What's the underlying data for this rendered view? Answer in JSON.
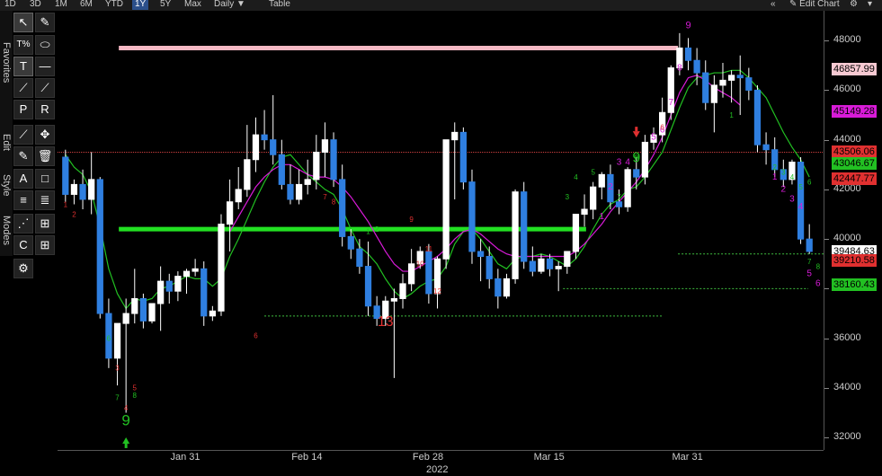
{
  "toolbar": {
    "ranges": [
      "1D",
      "3D",
      "1M",
      "6M",
      "YTD",
      "1Y",
      "5Y",
      "Max"
    ],
    "active_range": "1Y",
    "period": "Daily",
    "period_arrow": "▼",
    "table": "Table",
    "collapse": "«",
    "edit_icon": "✎",
    "edit_chart": "Edit Chart",
    "gear": "⚙",
    "menu": "▾"
  },
  "side_tabs": [
    "Favorites",
    "Edit",
    "Style",
    "Modes"
  ],
  "tools": [
    "↖",
    "T%",
    "⬭",
    "T",
    "—",
    "⟋",
    "⟋",
    "P",
    "R",
    "⟋",
    "✥",
    "✎",
    "🗑",
    "A",
    "□",
    "≡",
    "≣",
    "⋰",
    "⊞",
    "C",
    "⊞",
    "⚙"
  ],
  "chart_data": {
    "type": "candlestick",
    "title": "",
    "xlabel": "2022",
    "ylabel": "",
    "ylim": [
      31500,
      49200
    ],
    "y_ticks": [
      32000,
      34000,
      36000,
      38000,
      40000,
      42000,
      44000,
      46000,
      48000
    ],
    "y_tick_labels": [
      "32000",
      "34000",
      "36000",
      "38000",
      "40000",
      "42000",
      "44000",
      "46000",
      "48000"
    ],
    "x_tick_labels": [
      "Jan 31",
      "Feb 14",
      "Feb 28",
      "Mar 15",
      "Mar 31"
    ],
    "x_tick_days": [
      14,
      28,
      42,
      56,
      72
    ],
    "x_year": "2022",
    "candles": [
      {
        "o": 43300,
        "h": 43600,
        "c": 41800,
        "l": 41500
      },
      {
        "o": 41800,
        "h": 42400,
        "c": 42200,
        "l": 41400
      },
      {
        "o": 42200,
        "h": 42800,
        "c": 41600,
        "l": 41200
      },
      {
        "o": 41600,
        "h": 43500,
        "c": 42400,
        "l": 41000
      },
      {
        "o": 42400,
        "h": 42500,
        "c": 37000,
        "l": 36800
      },
      {
        "o": 37000,
        "h": 37600,
        "c": 35200,
        "l": 34800
      },
      {
        "o": 35200,
        "h": 36500,
        "c": 36600,
        "l": 34100
      },
      {
        "o": 36600,
        "h": 37600,
        "c": 37000,
        "l": 33000
      },
      {
        "o": 37000,
        "h": 38800,
        "c": 37600,
        "l": 36600
      },
      {
        "o": 37600,
        "h": 37800,
        "c": 36700,
        "l": 36400
      },
      {
        "o": 36700,
        "h": 37300,
        "c": 37400,
        "l": 36600
      },
      {
        "o": 37400,
        "h": 38900,
        "c": 38300,
        "l": 36300
      },
      {
        "o": 38300,
        "h": 38600,
        "c": 37900,
        "l": 37400
      },
      {
        "o": 37900,
        "h": 38700,
        "c": 38500,
        "l": 37500
      },
      {
        "o": 38500,
        "h": 38800,
        "c": 38700,
        "l": 37800
      },
      {
        "o": 38700,
        "h": 39200,
        "c": 38800,
        "l": 38500
      },
      {
        "o": 38800,
        "h": 39100,
        "c": 36900,
        "l": 36500
      },
      {
        "o": 36900,
        "h": 37300,
        "c": 37100,
        "l": 36700
      },
      {
        "o": 37100,
        "h": 41000,
        "c": 40600,
        "l": 36900
      },
      {
        "o": 40600,
        "h": 42400,
        "c": 41500,
        "l": 39500
      },
      {
        "o": 41500,
        "h": 42900,
        "c": 42000,
        "l": 41200
      },
      {
        "o": 42000,
        "h": 44600,
        "c": 43200,
        "l": 41700
      },
      {
        "o": 43200,
        "h": 44900,
        "c": 44200,
        "l": 42700
      },
      {
        "o": 44200,
        "h": 45200,
        "c": 44000,
        "l": 43600
      },
      {
        "o": 44000,
        "h": 45800,
        "c": 43400,
        "l": 43000
      },
      {
        "o": 43400,
        "h": 44000,
        "c": 42200,
        "l": 42000
      },
      {
        "o": 42200,
        "h": 43000,
        "c": 41600,
        "l": 41400
      },
      {
        "o": 41600,
        "h": 42800,
        "c": 42200,
        "l": 41400
      },
      {
        "o": 42200,
        "h": 43200,
        "c": 42400,
        "l": 41800
      },
      {
        "o": 42400,
        "h": 44200,
        "c": 43500,
        "l": 42000
      },
      {
        "o": 43500,
        "h": 44700,
        "c": 44000,
        "l": 42500
      },
      {
        "o": 44000,
        "h": 44300,
        "c": 42400,
        "l": 42100
      },
      {
        "o": 42400,
        "h": 43000,
        "c": 40100,
        "l": 39700
      },
      {
        "o": 40100,
        "h": 40400,
        "c": 39600,
        "l": 39200
      },
      {
        "o": 39600,
        "h": 40000,
        "c": 38900,
        "l": 38600
      },
      {
        "o": 38900,
        "h": 39900,
        "c": 37300,
        "l": 36900
      },
      {
        "o": 37300,
        "h": 37700,
        "c": 36800,
        "l": 36500
      },
      {
        "o": 36800,
        "h": 37700,
        "c": 37500,
        "l": 36500
      },
      {
        "o": 37500,
        "h": 38000,
        "c": 37600,
        "l": 34400
      },
      {
        "o": 37600,
        "h": 38600,
        "c": 38200,
        "l": 37200
      },
      {
        "o": 38200,
        "h": 39600,
        "c": 39000,
        "l": 37900
      },
      {
        "o": 39000,
        "h": 39700,
        "c": 39500,
        "l": 38800
      },
      {
        "o": 39500,
        "h": 39800,
        "c": 37800,
        "l": 37400
      },
      {
        "o": 37800,
        "h": 39300,
        "c": 39200,
        "l": 37200
      },
      {
        "o": 39200,
        "h": 44000,
        "c": 44000,
        "l": 38800
      },
      {
        "o": 44000,
        "h": 44700,
        "c": 44300,
        "l": 41600
      },
      {
        "o": 44300,
        "h": 44500,
        "c": 42300,
        "l": 42000
      },
      {
        "o": 42300,
        "h": 42800,
        "c": 39500,
        "l": 39000
      },
      {
        "o": 39500,
        "h": 40000,
        "c": 39300,
        "l": 38300
      },
      {
        "o": 39300,
        "h": 39700,
        "c": 38400,
        "l": 38000
      },
      {
        "o": 38400,
        "h": 38800,
        "c": 37700,
        "l": 37200
      },
      {
        "o": 37700,
        "h": 38600,
        "c": 38400,
        "l": 37600
      },
      {
        "o": 38400,
        "h": 42000,
        "c": 41900,
        "l": 38200
      },
      {
        "o": 41900,
        "h": 42300,
        "c": 39100,
        "l": 38800
      },
      {
        "o": 39100,
        "h": 39700,
        "c": 38700,
        "l": 38500
      },
      {
        "o": 38700,
        "h": 39400,
        "c": 39200,
        "l": 38600
      },
      {
        "o": 39200,
        "h": 39400,
        "c": 38800,
        "l": 38500
      },
      {
        "o": 38800,
        "h": 39100,
        "c": 38900,
        "l": 37900
      },
      {
        "o": 38900,
        "h": 39500,
        "c": 39500,
        "l": 38600
      },
      {
        "o": 39500,
        "h": 40800,
        "c": 41000,
        "l": 39200
      },
      {
        "o": 41000,
        "h": 41800,
        "c": 41200,
        "l": 40500
      },
      {
        "o": 41200,
        "h": 42300,
        "c": 42100,
        "l": 40800
      },
      {
        "o": 42100,
        "h": 42700,
        "c": 42600,
        "l": 41600
      },
      {
        "o": 42600,
        "h": 43000,
        "c": 41500,
        "l": 41200
      },
      {
        "o": 41500,
        "h": 42000,
        "c": 41300,
        "l": 41000
      },
      {
        "o": 41300,
        "h": 42900,
        "c": 42800,
        "l": 41100
      },
      {
        "o": 42800,
        "h": 43300,
        "c": 42500,
        "l": 42000
      },
      {
        "o": 42500,
        "h": 44200,
        "c": 43900,
        "l": 42200
      },
      {
        "o": 43900,
        "h": 44500,
        "c": 44200,
        "l": 43600
      },
      {
        "o": 44200,
        "h": 45700,
        "c": 45100,
        "l": 43900
      },
      {
        "o": 45100,
        "h": 47000,
        "c": 46900,
        "l": 44800
      },
      {
        "o": 46900,
        "h": 48300,
        "c": 47700,
        "l": 46600
      },
      {
        "o": 47700,
        "h": 48100,
        "c": 47200,
        "l": 46800
      },
      {
        "o": 47200,
        "h": 47700,
        "c": 46700,
        "l": 46200
      },
      {
        "o": 46700,
        "h": 47200,
        "c": 45500,
        "l": 45200
      },
      {
        "o": 45500,
        "h": 46600,
        "c": 46200,
        "l": 44300
      },
      {
        "o": 46200,
        "h": 47100,
        "c": 46400,
        "l": 45700
      },
      {
        "o": 46400,
        "h": 46800,
        "c": 46600,
        "l": 45500
      },
      {
        "o": 46600,
        "h": 47400,
        "c": 46500,
        "l": 45000
      },
      {
        "o": 46500,
        "h": 46900,
        "c": 46000,
        "l": 45600
      },
      {
        "o": 46000,
        "h": 46200,
        "c": 43800,
        "l": 43500
      },
      {
        "o": 43800,
        "h": 44300,
        "c": 43600,
        "l": 43000
      },
      {
        "o": 43600,
        "h": 44100,
        "c": 42800,
        "l": 42500
      },
      {
        "o": 42800,
        "h": 43200,
        "c": 42400,
        "l": 42100
      },
      {
        "o": 42400,
        "h": 43200,
        "c": 43100,
        "l": 42200
      },
      {
        "o": 43100,
        "h": 43300,
        "c": 40000,
        "l": 39800
      },
      {
        "o": 40000,
        "h": 40600,
        "c": 39500,
        "l": 39400
      }
    ],
    "horizontal_lines": [
      {
        "value": 47700,
        "color": "#f5b8c4",
        "kind": "thick",
        "start": 0.08,
        "end": 0.81
      },
      {
        "value": 40400,
        "color": "#22e022",
        "kind": "thick",
        "start": 0.08,
        "end": 0.69
      },
      {
        "value": 43500,
        "color": "#d04040",
        "kind": "thin",
        "start": 0.0,
        "end": 1.0
      },
      {
        "value": 36900,
        "color": "#3fbf3f",
        "kind": "dotted",
        "start": 0.27,
        "end": 0.79
      },
      {
        "value": 39400,
        "color": "#3fbf3f",
        "kind": "dotted",
        "start": 0.81,
        "end": 1.0
      },
      {
        "value": 38000,
        "color": "#3fbf3f",
        "kind": "dotted",
        "start": 0.66,
        "end": 0.98
      }
    ],
    "price_labels": [
      {
        "text": "46857.99",
        "bg": "#f7c9d2",
        "value": 46857.99
      },
      {
        "text": "45149.28",
        "bg": "#d81bd8",
        "value": 45149.28
      },
      {
        "text": "43506.06",
        "bg": "#e03030",
        "value": 43506.06
      },
      {
        "text": "43046.67",
        "bg": "#22c022",
        "value": 43046.67
      },
      {
        "text": "42447.77",
        "bg": "#e03030",
        "value": 42447.77
      },
      {
        "text": "39484.63",
        "bg": "#ffffff",
        "value": 39484.63
      },
      {
        "text": "39210.58",
        "bg": "#e03030",
        "value": 39150
      },
      {
        "text": "38160.43",
        "bg": "#22c022",
        "value": 38160.43
      }
    ],
    "annotations": [
      {
        "text": "9",
        "color": "#22c022",
        "i": 7,
        "v": 32500,
        "size": 17
      },
      {
        "text": "13",
        "color": "#e03030",
        "i": 37,
        "v": 36500,
        "size": 16
      },
      {
        "text": "9",
        "color": "#22c022",
        "i": 66,
        "v": 43100,
        "size": 16
      },
      {
        "text": "9",
        "color": "#d81bd8",
        "i": 72,
        "v": 48500,
        "size": 11
      },
      {
        "text": "1",
        "color": "#d81bd8",
        "i": 62,
        "v": 40800,
        "size": 10
      },
      {
        "text": "2",
        "color": "#d81bd8",
        "i": 63,
        "v": 42000,
        "size": 10
      },
      {
        "text": "3",
        "color": "#d81bd8",
        "i": 64,
        "v": 43000,
        "size": 10
      },
      {
        "text": "4",
        "color": "#d81bd8",
        "i": 65,
        "v": 43000,
        "size": 10
      },
      {
        "text": "5",
        "color": "#d81bd8",
        "i": 68,
        "v": 44000,
        "size": 10
      },
      {
        "text": "6",
        "color": "#d81bd8",
        "i": 69,
        "v": 44300,
        "size": 10
      },
      {
        "text": "7",
        "color": "#d81bd8",
        "i": 70,
        "v": 45400,
        "size": 10
      },
      {
        "text": "8",
        "color": "#d81bd8",
        "i": 71,
        "v": 46800,
        "size": 10
      },
      {
        "text": "1",
        "color": "#d81bd8",
        "i": 82,
        "v": 42400,
        "size": 10
      },
      {
        "text": "2",
        "color": "#d81bd8",
        "i": 83,
        "v": 41900,
        "size": 10
      },
      {
        "text": "3",
        "color": "#d81bd8",
        "i": 84,
        "v": 41500,
        "size": 10
      },
      {
        "text": "4",
        "color": "#d81bd8",
        "i": 85,
        "v": 41200,
        "size": 10
      },
      {
        "text": "5",
        "color": "#d81bd8",
        "i": 86,
        "v": 38500,
        "size": 10
      },
      {
        "text": "6",
        "color": "#d81bd8",
        "i": 87,
        "v": 38100,
        "size": 10
      },
      {
        "text": "1",
        "color": "#e03030",
        "i": 0,
        "v": 41300,
        "size": 8
      },
      {
        "text": "2",
        "color": "#e03030",
        "i": 1,
        "v": 40900,
        "size": 8
      },
      {
        "text": "3",
        "color": "#e03030",
        "i": 6,
        "v": 34700,
        "size": 8
      },
      {
        "text": "4",
        "color": "#e03030",
        "i": 7,
        "v": 33100,
        "size": 8
      },
      {
        "text": "5",
        "color": "#e03030",
        "i": 8,
        "v": 33900,
        "size": 8
      },
      {
        "text": "6",
        "color": "#e03030",
        "i": 22,
        "v": 36000,
        "size": 8
      },
      {
        "text": "7",
        "color": "#e03030",
        "i": 30,
        "v": 41600,
        "size": 8
      },
      {
        "text": "8",
        "color": "#e03030",
        "i": 31,
        "v": 41400,
        "size": 8
      },
      {
        "text": "9",
        "color": "#e03030",
        "i": 40,
        "v": 40700,
        "size": 8
      },
      {
        "text": "10",
        "color": "#e03030",
        "i": 41,
        "v": 38900,
        "size": 8
      },
      {
        "text": "11",
        "color": "#e03030",
        "i": 42,
        "v": 39500,
        "size": 8
      },
      {
        "text": "12",
        "color": "#e03030",
        "i": 43,
        "v": 37800,
        "size": 8
      },
      {
        "text": "6",
        "color": "#e03030",
        "i": 69,
        "v": 44400,
        "size": 8
      },
      {
        "text": "6",
        "color": "#22c022",
        "i": 5,
        "v": 35900,
        "size": 8
      },
      {
        "text": "7",
        "color": "#22c022",
        "i": 6,
        "v": 33500,
        "size": 8
      },
      {
        "text": "8",
        "color": "#22c022",
        "i": 8,
        "v": 33600,
        "size": 8
      },
      {
        "text": "1",
        "color": "#22c022",
        "i": 35,
        "v": 40200,
        "size": 8
      },
      {
        "text": "2",
        "color": "#22c022",
        "i": 36,
        "v": 40300,
        "size": 8
      },
      {
        "text": "3",
        "color": "#22c022",
        "i": 58,
        "v": 41600,
        "size": 8
      },
      {
        "text": "4",
        "color": "#22c022",
        "i": 59,
        "v": 42400,
        "size": 8
      },
      {
        "text": "5",
        "color": "#22c022",
        "i": 61,
        "v": 42600,
        "size": 8
      },
      {
        "text": "7",
        "color": "#22c022",
        "i": 64,
        "v": 41600,
        "size": 8
      },
      {
        "text": "8",
        "color": "#22c022",
        "i": 66,
        "v": 43200,
        "size": 8
      },
      {
        "text": "1",
        "color": "#22c022",
        "i": 77,
        "v": 44900,
        "size": 8
      },
      {
        "text": "2",
        "color": "#22c022",
        "i": 82,
        "v": 42800,
        "size": 8
      },
      {
        "text": "3",
        "color": "#22c022",
        "i": 83,
        "v": 42600,
        "size": 8
      },
      {
        "text": "4",
        "color": "#22c022",
        "i": 84,
        "v": 42400,
        "size": 8
      },
      {
        "text": "5",
        "color": "#22c022",
        "i": 85,
        "v": 42000,
        "size": 8
      },
      {
        "text": "6",
        "color": "#22c022",
        "i": 86,
        "v": 42200,
        "size": 8
      },
      {
        "text": "7",
        "color": "#22c022",
        "i": 86,
        "v": 39000,
        "size": 8
      },
      {
        "text": "8",
        "color": "#22c022",
        "i": 87,
        "v": 38800,
        "size": 8
      }
    ],
    "arrows": [
      {
        "color": "#22c022",
        "i": 7,
        "v": 31900,
        "dir": "up"
      },
      {
        "color": "#e03030",
        "i": 66,
        "v": 44200,
        "dir": "down"
      }
    ],
    "green_line_values": [
      43400,
      42900,
      42600,
      41900,
      40500,
      38800,
      37800,
      37200,
      37600,
      37500,
      37600,
      38000,
      38100,
      38300,
      38500,
      38400,
      38400,
      38100,
      38400,
      39300,
      40000,
      40800,
      41600,
      42300,
      42900,
      43300,
      43400,
      43000,
      42600,
      42300,
      42000,
      41800,
      41200,
      40400,
      39700,
      39400,
      39000,
      38400,
      37900,
      37600,
      37800,
      38100,
      38300,
      38400,
      38900,
      39800,
      40300,
      40400,
      40000,
      39500,
      39000,
      38800,
      39200,
      39300,
      39300,
      39400,
      39300,
      39100,
      38900,
      39200,
      39700,
      40400,
      41000,
      41400,
      41600,
      42000,
      42100,
      42500,
      43000,
      43500,
      44400,
      45300,
      46100,
      46500,
      46600,
      46700,
      46700,
      46800,
      46800,
      46500,
      46100,
      45700,
      45000,
      44300,
      43700,
      43200,
      42500
    ],
    "magenta_line_values": [
      null,
      null,
      null,
      null,
      null,
      null,
      null,
      null,
      null,
      null,
      null,
      null,
      null,
      null,
      null,
      null,
      null,
      null,
      null,
      40300,
      40900,
      41500,
      42100,
      42500,
      42800,
      43000,
      43000,
      42800,
      42600,
      42500,
      42500,
      42400,
      42100,
      41700,
      41200,
      40700,
      40100,
      39500,
      39000,
      38700,
      38700,
      38900,
      39100,
      39300,
      39600,
      40000,
      40300,
      40400,
      40200,
      39900,
      39600,
      39400,
      39300,
      39300,
      39300,
      39300,
      39300,
      39300,
      39300,
      39500,
      39800,
      40200,
      40600,
      41100,
      41500,
      41900,
      42300,
      42800,
      43400,
      44100,
      45000,
      45900,
      46500,
      46600,
      46400,
      46100,
      45900,
      45700,
      45400,
      null,
      null,
      null,
      null,
      null,
      null,
      null,
      null
    ]
  }
}
